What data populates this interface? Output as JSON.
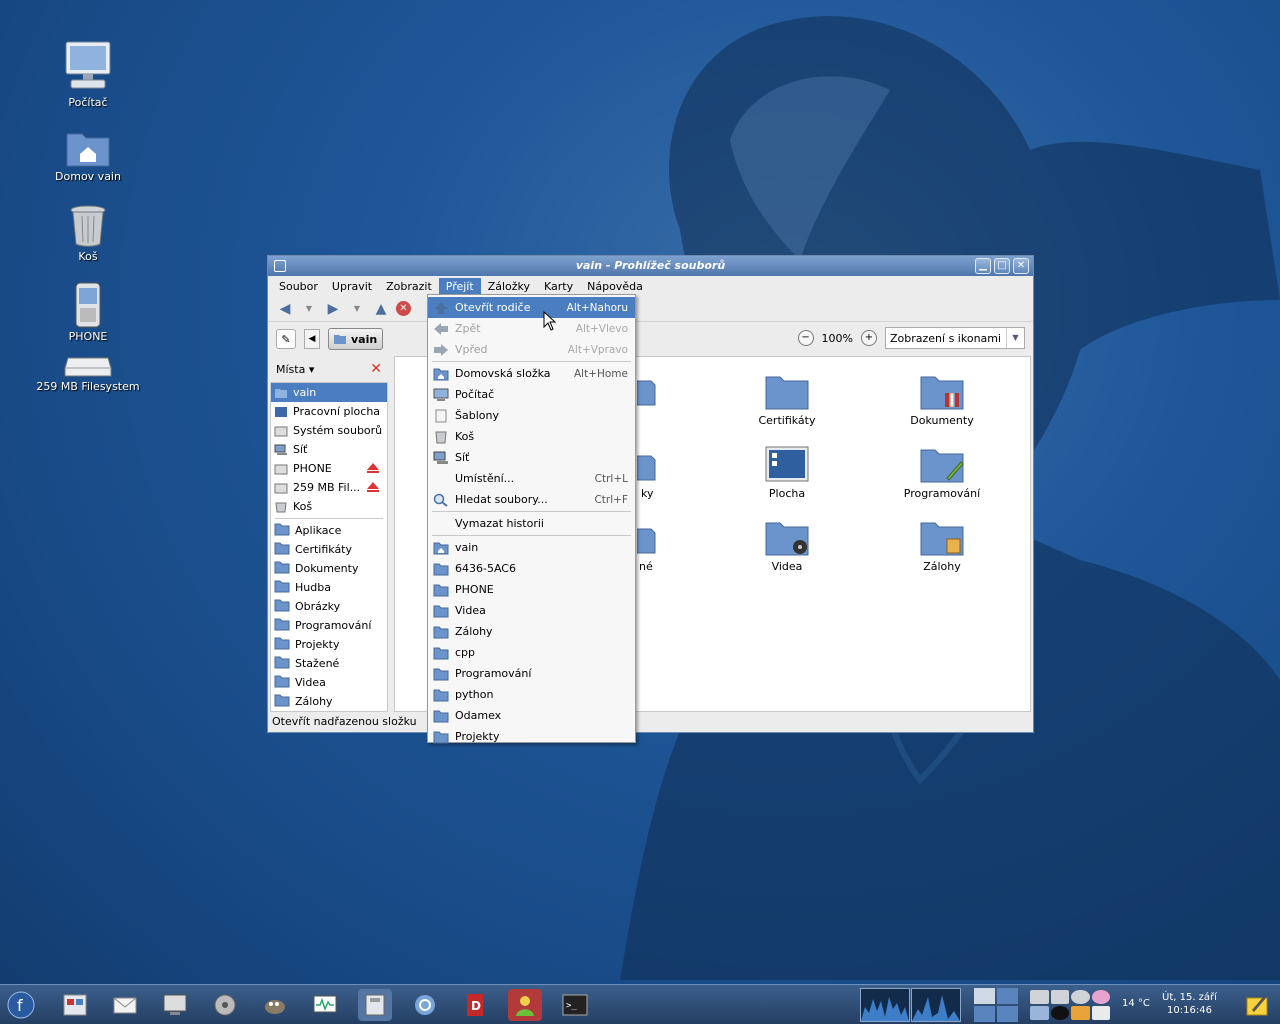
{
  "desktop": {
    "icons": [
      {
        "label": "Počítač"
      },
      {
        "label": "Domov vain"
      },
      {
        "label": "Koš"
      },
      {
        "label": "PHONE"
      },
      {
        "label": "259 MB Filesystem"
      }
    ]
  },
  "window": {
    "title": "vain - Prohlížeč souborů",
    "buttons": {
      "minimize": "▁",
      "maximize": "□",
      "close": "✕"
    },
    "menubar": [
      "Soubor",
      "Upravit",
      "Zobrazit",
      "Přejít",
      "Záložky",
      "Karty",
      "Nápověda"
    ],
    "breadcrumb": "vain",
    "zoom_level": "100%",
    "view_mode": "Zobrazení s ikonami",
    "sidebar": {
      "header": "Místa",
      "places": [
        {
          "label": "vain",
          "icon": "home-folder-icon"
        },
        {
          "label": "Pracovní plocha",
          "icon": "desktop-icon"
        },
        {
          "label": "Systém souborů",
          "icon": "drive-icon"
        },
        {
          "label": "Síť",
          "icon": "network-icon"
        },
        {
          "label": "PHONE",
          "icon": "drive-icon"
        },
        {
          "label": "259 MB Fil...",
          "icon": "drive-icon"
        },
        {
          "label": "Koš",
          "icon": "trash-icon"
        }
      ],
      "bookmarks": [
        "Aplikace",
        "Certifikáty",
        "Dokumenty",
        "Hudba",
        "Obrázky",
        "Programování",
        "Projekty",
        "Stažené",
        "Videa",
        "Zálohy"
      ]
    },
    "files": [
      {
        "label": "Certifikáty"
      },
      {
        "label": "Dokumenty"
      },
      {
        "label": "Plocha"
      },
      {
        "label": "Programování"
      },
      {
        "label": "Videa"
      },
      {
        "label": "Zálohy"
      }
    ],
    "partial_labels": [
      "ky",
      "né"
    ],
    "status": "Otevřít nadřazenou složku"
  },
  "dropdown": {
    "items": [
      {
        "label": "Otevřít rodiče",
        "accel": "Alt+Nahoru",
        "icon": "up-arrow-icon",
        "state": "highlighted"
      },
      {
        "label": "Zpět",
        "accel": "Alt+Vlevo",
        "icon": "back-arrow-icon",
        "state": "disabled"
      },
      {
        "label": "Vpřed",
        "accel": "Alt+Vpravo",
        "icon": "forward-arrow-icon",
        "state": "disabled"
      },
      {
        "label": "Domovská složka",
        "accel": "Alt+Home",
        "icon": "home-folder-icon"
      },
      {
        "label": "Počítač",
        "accel": "",
        "icon": "computer-icon"
      },
      {
        "label": "Šablony",
        "accel": "",
        "icon": "template-icon"
      },
      {
        "label": "Koš",
        "accel": "",
        "icon": "trash-icon"
      },
      {
        "label": "Síť",
        "accel": "",
        "icon": "network-icon"
      },
      {
        "label": "Umístění...",
        "accel": "Ctrl+L",
        "icon": ""
      },
      {
        "label": "Hledat soubory...",
        "accel": "Ctrl+F",
        "icon": "search-icon"
      },
      {
        "label": "Vymazat historii",
        "accel": "",
        "icon": ""
      },
      {
        "label": "vain",
        "icon": "home-folder-icon"
      },
      {
        "label": "6436-5AC6",
        "icon": "folder-icon"
      },
      {
        "label": "PHONE",
        "icon": "folder-icon"
      },
      {
        "label": "Videa",
        "icon": "folder-icon"
      },
      {
        "label": "Zálohy",
        "icon": "folder-icon"
      },
      {
        "label": "cpp",
        "icon": "folder-icon"
      },
      {
        "label": "Programování",
        "icon": "folder-icon"
      },
      {
        "label": "python",
        "icon": "folder-icon"
      },
      {
        "label": "Odamex",
        "icon": "folder-icon"
      },
      {
        "label": "Projekty",
        "icon": "folder-icon"
      }
    ]
  },
  "taskbar": {
    "temperature": "14 °C",
    "clock_date": "Út, 15. září",
    "clock_time": "10:16:46"
  },
  "colors": {
    "accent": "#4a7ec1",
    "desktop": "#1f5799",
    "folder": "#6b94cc"
  }
}
